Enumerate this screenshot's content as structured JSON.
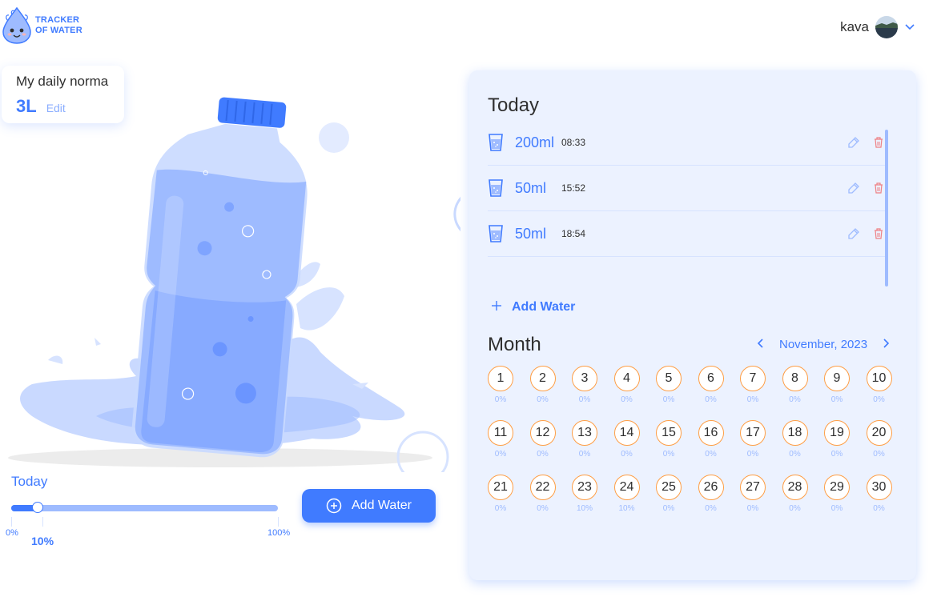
{
  "header": {
    "logo_line1": "TRACKER",
    "logo_line2": "OF WATER",
    "user_name": "kava"
  },
  "norma": {
    "title": "My daily norma",
    "value": "3L",
    "edit_label": "Edit"
  },
  "today_progress": {
    "label": "Today",
    "percent": 10,
    "tick_min": "0%",
    "tick_current": "10%",
    "tick_max": "100%"
  },
  "add_button_label": "Add Water",
  "today_panel": {
    "title": "Today",
    "entries": [
      {
        "amount": "200ml",
        "time": "08:33"
      },
      {
        "amount": "50ml",
        "time": "15:52"
      },
      {
        "amount": "50ml",
        "time": "18:54"
      }
    ],
    "add_label": "Add Water"
  },
  "month_panel": {
    "title": "Month",
    "month_label": "November, 2023",
    "prev_icon": "chevron-left-icon",
    "next_icon": "chevron-right-icon",
    "days": [
      {
        "day": "1",
        "pct": "0%"
      },
      {
        "day": "2",
        "pct": "0%"
      },
      {
        "day": "3",
        "pct": "0%"
      },
      {
        "day": "4",
        "pct": "0%"
      },
      {
        "day": "5",
        "pct": "0%"
      },
      {
        "day": "6",
        "pct": "0%"
      },
      {
        "day": "7",
        "pct": "0%"
      },
      {
        "day": "8",
        "pct": "0%"
      },
      {
        "day": "9",
        "pct": "0%"
      },
      {
        "day": "10",
        "pct": "0%"
      },
      {
        "day": "11",
        "pct": "0%"
      },
      {
        "day": "12",
        "pct": "0%"
      },
      {
        "day": "13",
        "pct": "0%"
      },
      {
        "day": "14",
        "pct": "0%"
      },
      {
        "day": "15",
        "pct": "0%"
      },
      {
        "day": "16",
        "pct": "0%"
      },
      {
        "day": "17",
        "pct": "0%"
      },
      {
        "day": "18",
        "pct": "0%"
      },
      {
        "day": "19",
        "pct": "0%"
      },
      {
        "day": "20",
        "pct": "0%"
      },
      {
        "day": "21",
        "pct": "0%"
      },
      {
        "day": "22",
        "pct": "0%"
      },
      {
        "day": "23",
        "pct": "10%"
      },
      {
        "day": "24",
        "pct": "10%"
      },
      {
        "day": "25",
        "pct": "0%"
      },
      {
        "day": "26",
        "pct": "0%"
      },
      {
        "day": "27",
        "pct": "0%"
      },
      {
        "day": "28",
        "pct": "0%"
      },
      {
        "day": "29",
        "pct": "0%"
      },
      {
        "day": "30",
        "pct": "0%"
      }
    ]
  },
  "colors": {
    "primary": "#407bff",
    "light_blue": "#9ebbff",
    "panel_bg": "#ecf2ff",
    "day_border": "#ff9d43",
    "delete_red": "#ef5050"
  }
}
